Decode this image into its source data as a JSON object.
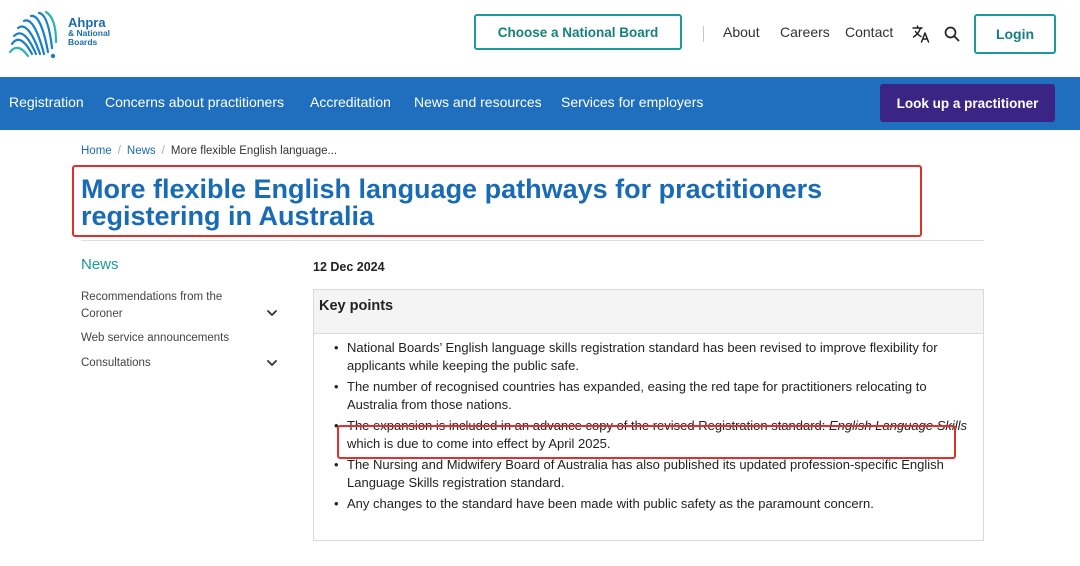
{
  "header": {
    "logo": {
      "brand": "Ahpra",
      "sub1": "& National",
      "sub2": "Boards"
    },
    "choose_board_label": "Choose a National Board",
    "links": [
      "About",
      "Careers",
      "Contact"
    ],
    "login_label": "Login"
  },
  "nav": {
    "items": [
      "Registration",
      "Concerns about practitioners",
      "Accreditation",
      "News and resources",
      "Services for employers"
    ],
    "lookup_label": "Look up a practitioner"
  },
  "breadcrumb": {
    "home": "Home",
    "news": "News",
    "current": "More flexible English language..."
  },
  "page": {
    "title": "More flexible English language pathways for practitioners registering in Australia",
    "date": "12 Dec 2024"
  },
  "sidebar": {
    "heading": "News",
    "items": [
      {
        "line1": "Recommendations from the",
        "line2": "Coroner"
      },
      {
        "line1": "Web service announcements"
      },
      {
        "line1": "Consultations"
      }
    ]
  },
  "key_points": {
    "heading": "Key points",
    "items": [
      "National Boards’ English language skills registration standard has been revised to improve flexibility for applicants while keeping the public safe.",
      "The number of recognised countries has expanded, easing the red tape for practitioners relocating to Australia from those nations.",
      {
        "before": "The expansion is included in an advance copy of the revised Registration standard: ",
        "italic": "English Language Skills",
        "after": " which is due to come into effect by April 2025."
      },
      "The Nursing and Midwifery Board of Australia has also published its updated profession-specific English Language Skills registration standard.",
      "Any changes to the standard have been made with public safety as the paramount concern."
    ]
  },
  "colors": {
    "teal": "#1a9a9a",
    "nav_blue": "#1f6fbe",
    "title_blue": "#1a6bb5",
    "purple": "#3b2584",
    "annotation_red": "#e0302b"
  },
  "icons": [
    "ahpra-logo-icon",
    "translate-icon",
    "search-icon",
    "chevron-down-icon"
  ]
}
